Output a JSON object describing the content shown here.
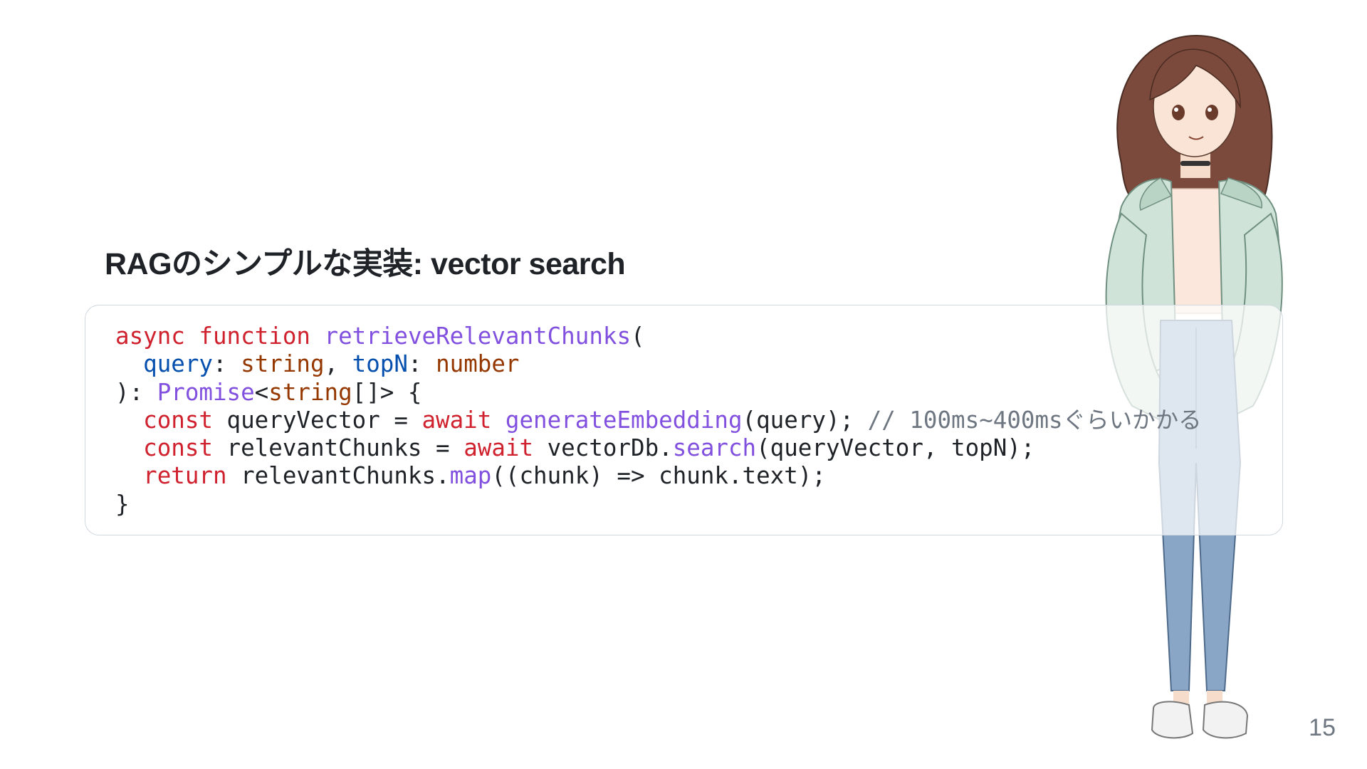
{
  "slide": {
    "title": "RAGのシンプルな実装: vector search",
    "page_number": "15"
  },
  "code": {
    "language": "typescript",
    "lines": [
      [
        {
          "t": "async",
          "k": "kw"
        },
        {
          "t": " ",
          "k": "tx"
        },
        {
          "t": "function",
          "k": "kw"
        },
        {
          "t": " ",
          "k": "tx"
        },
        {
          "t": "retrieveRelevantChunks",
          "k": "fn"
        },
        {
          "t": "(",
          "k": "tx"
        }
      ],
      [
        {
          "t": "  ",
          "k": "tx"
        },
        {
          "t": "query",
          "k": "par"
        },
        {
          "t": ": ",
          "k": "tx"
        },
        {
          "t": "string",
          "k": "ty"
        },
        {
          "t": ", ",
          "k": "tx"
        },
        {
          "t": "topN",
          "k": "par"
        },
        {
          "t": ": ",
          "k": "tx"
        },
        {
          "t": "number",
          "k": "ty"
        }
      ],
      [
        {
          "t": "): ",
          "k": "tx"
        },
        {
          "t": "Promise",
          "k": "fn"
        },
        {
          "t": "<",
          "k": "tx"
        },
        {
          "t": "string",
          "k": "ty"
        },
        {
          "t": "[]> {",
          "k": "tx"
        }
      ],
      [
        {
          "t": "  ",
          "k": "tx"
        },
        {
          "t": "const",
          "k": "kw"
        },
        {
          "t": " queryVector = ",
          "k": "tx"
        },
        {
          "t": "await",
          "k": "kw"
        },
        {
          "t": " ",
          "k": "tx"
        },
        {
          "t": "generateEmbedding",
          "k": "fn"
        },
        {
          "t": "(query); ",
          "k": "tx"
        },
        {
          "t": "// 100ms~400msぐらいかかる",
          "k": "cm"
        }
      ],
      [
        {
          "t": "  ",
          "k": "tx"
        },
        {
          "t": "const",
          "k": "kw"
        },
        {
          "t": " relevantChunks = ",
          "k": "tx"
        },
        {
          "t": "await",
          "k": "kw"
        },
        {
          "t": " vectorDb.",
          "k": "tx"
        },
        {
          "t": "search",
          "k": "fn"
        },
        {
          "t": "(queryVector, topN);",
          "k": "tx"
        }
      ],
      [
        {
          "t": "  ",
          "k": "tx"
        },
        {
          "t": "return",
          "k": "kw"
        },
        {
          "t": " relevantChunks.",
          "k": "tx"
        },
        {
          "t": "map",
          "k": "fn"
        },
        {
          "t": "((chunk) => chunk.text);",
          "k": "tx"
        }
      ],
      [
        {
          "t": "}",
          "k": "tx"
        }
      ]
    ]
  },
  "colors": {
    "keyword": "#cf222e",
    "function": "#8250df",
    "parameter": "#0550ae",
    "type": "#953800",
    "comment": "#6e7781",
    "text": "#1f2328",
    "code_border": "#d0d7de",
    "title": "#1f2328",
    "page_number": "#6e7781"
  },
  "illustration": {
    "icon": "anime-girl-illustration"
  }
}
